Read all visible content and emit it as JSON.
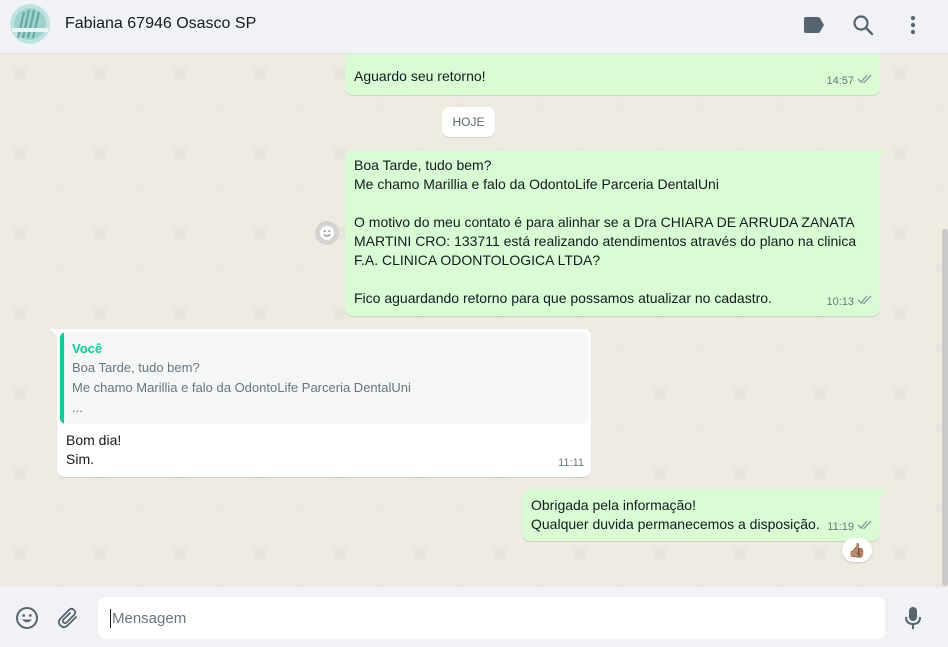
{
  "header": {
    "contact_name": "Fabiana 67946 Osasco SP",
    "icons": [
      "label-icon",
      "search-icon",
      "menu-icon"
    ]
  },
  "date_divider": "HOJE",
  "messages": [
    {
      "direction": "out",
      "text": "Aguardo seu retorno!",
      "time": "14:57",
      "status": "read"
    },
    {
      "direction": "out",
      "text": "Boa Tarde, tudo bem?\nMe chamo Marillia e falo da OdontoLife Parceria DentalUni\n\nO motivo do meu contato é para alinhar se a Dra CHIARA DE ARRUDA ZANATA\nMARTINI CRO: 133711 está realizando atendimentos através do plano na clinica\nF.A. CLINICA ODONTOLOGICA LTDA?\n\nFico aguardando retorno para que possamos atualizar no cadastro.",
      "time": "10:13",
      "status": "read"
    },
    {
      "direction": "in",
      "quote_author": "Você",
      "quote_text": "Boa Tarde, tudo bem?\nMe chamo Marillia e falo da OdontoLife Parceria DentalUni\n...",
      "text": "Bom dia!\nSim.",
      "time": "11:11"
    },
    {
      "direction": "out",
      "text": "Obrigada pela informação!\nQualquer duvida permanecemos a disposição.",
      "time": "11:19",
      "status": "read",
      "reaction": "👍🏽"
    }
  ],
  "composer": {
    "placeholder": "Mensagem",
    "icons": [
      "emoji-icon",
      "attach-icon",
      "microphone-icon"
    ]
  },
  "colors": {
    "outgoing_bubble": "#d9fdd3",
    "incoming_bubble": "#ffffff",
    "accent": "#06cf9c",
    "read_ticks": "#8696a0",
    "chat_background": "#efeae2"
  }
}
